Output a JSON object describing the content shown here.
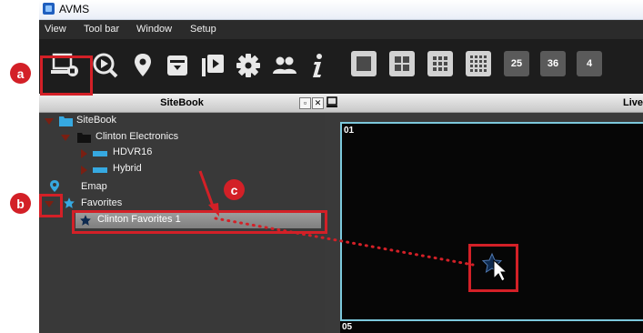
{
  "window": {
    "title": "AVMS"
  },
  "menu": [
    "View",
    "Tool bar",
    "Window",
    "Setup"
  ],
  "toolbar": {
    "icons": [
      "monitor-icon",
      "playback-icon",
      "location-pin-icon",
      "archive-icon",
      "video-playlist-icon",
      "gear-icon",
      "users-icon",
      "info-icon"
    ],
    "layout_buttons": [
      "1x1",
      "2x2",
      "3x3",
      "4x4"
    ],
    "number_buttons": [
      "25",
      "36",
      "4"
    ]
  },
  "sitebook": {
    "title": "SiteBook",
    "controls": [
      "restore",
      "close"
    ],
    "tree": {
      "root": "SiteBook",
      "group": "Clinton Electronics",
      "device1": "HDVR16",
      "device2": "Hybrid",
      "emap": "Emap",
      "favorites": "Favorites",
      "favorite_item": "Clinton Favorites 1"
    }
  },
  "live": {
    "title": "Live",
    "cell1": "01",
    "cell2": "05"
  },
  "callouts": {
    "a": "a",
    "b": "b",
    "c": "c"
  },
  "colors": {
    "callout": "#d32027",
    "cell_border": "#7cc8dc",
    "tree_arrow": "#7a1f12",
    "folder_blue": "#36a9e1",
    "star_blue": "#1e73be"
  }
}
